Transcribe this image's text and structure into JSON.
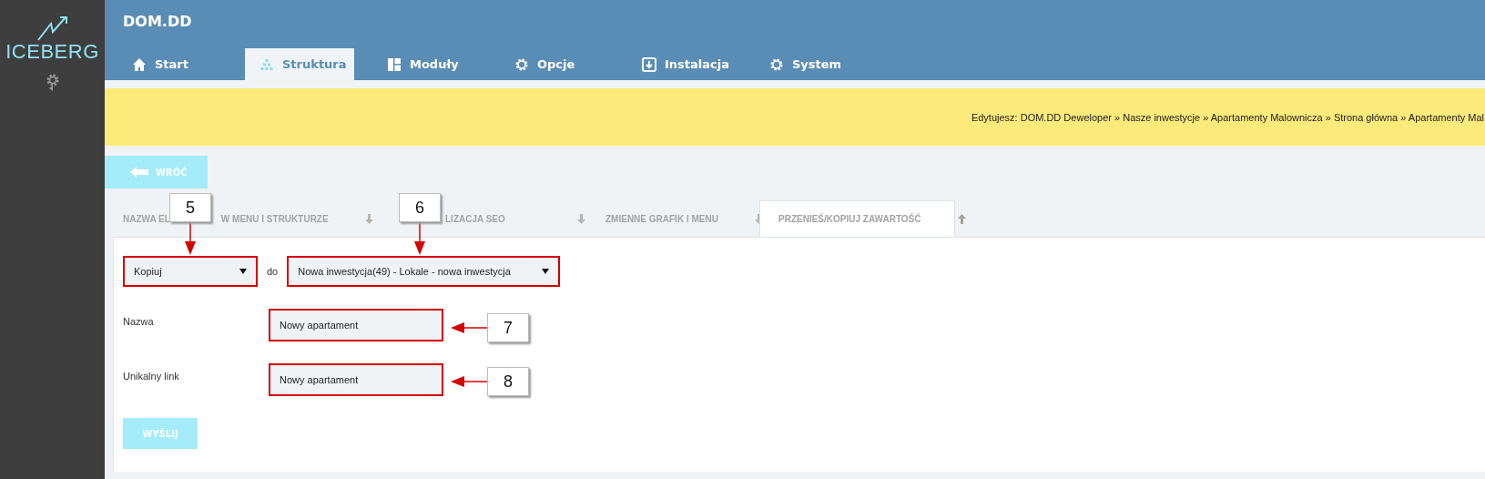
{
  "sidebar": {
    "logo_text": "ICEBERG"
  },
  "header": {
    "title": "DOM.DD"
  },
  "tabs": [
    {
      "label": "Start",
      "selected": false
    },
    {
      "label": "Struktura",
      "selected": true
    },
    {
      "label": "Moduły",
      "selected": false
    },
    {
      "label": "Opcje",
      "selected": false
    },
    {
      "label": "Instalacja",
      "selected": false
    },
    {
      "label": "System",
      "selected": false
    }
  ],
  "breadcrumb": "Edytujesz: DOM.DD Deweloper » Nasze inwestycje » Apartamenty Malownicza » Strona główna » Apartamenty Mal",
  "back_button": "WRÓĆ",
  "section_tabs": [
    {
      "parts": [
        "NAZWA EL",
        "W MENU I STRUKTURZE"
      ],
      "selected": false
    },
    {
      "parts": [
        "LIZACJA SEO"
      ],
      "selected": false
    },
    {
      "parts": [
        "ZMIENNE GRAFIK I MENU"
      ],
      "selected": false
    },
    {
      "parts": [
        "PRZENIEŚ/KOPIUJ ZAWARTOŚĆ"
      ],
      "selected": true
    }
  ],
  "action_select": {
    "value": "Kopiuj"
  },
  "connector": "do",
  "target_select": {
    "value": "Nowa inwestycja(49) - Lokale - nowa inwestycja"
  },
  "fields": [
    {
      "label": "Nazwa",
      "value": "Nowy apartament"
    },
    {
      "label": "Unikalny link",
      "value": "Nowy apartament"
    }
  ],
  "submit_button": "WYŚLIJ",
  "callouts": [
    {
      "number": "5"
    },
    {
      "number": "6"
    },
    {
      "number": "7"
    },
    {
      "number": "8"
    }
  ]
}
